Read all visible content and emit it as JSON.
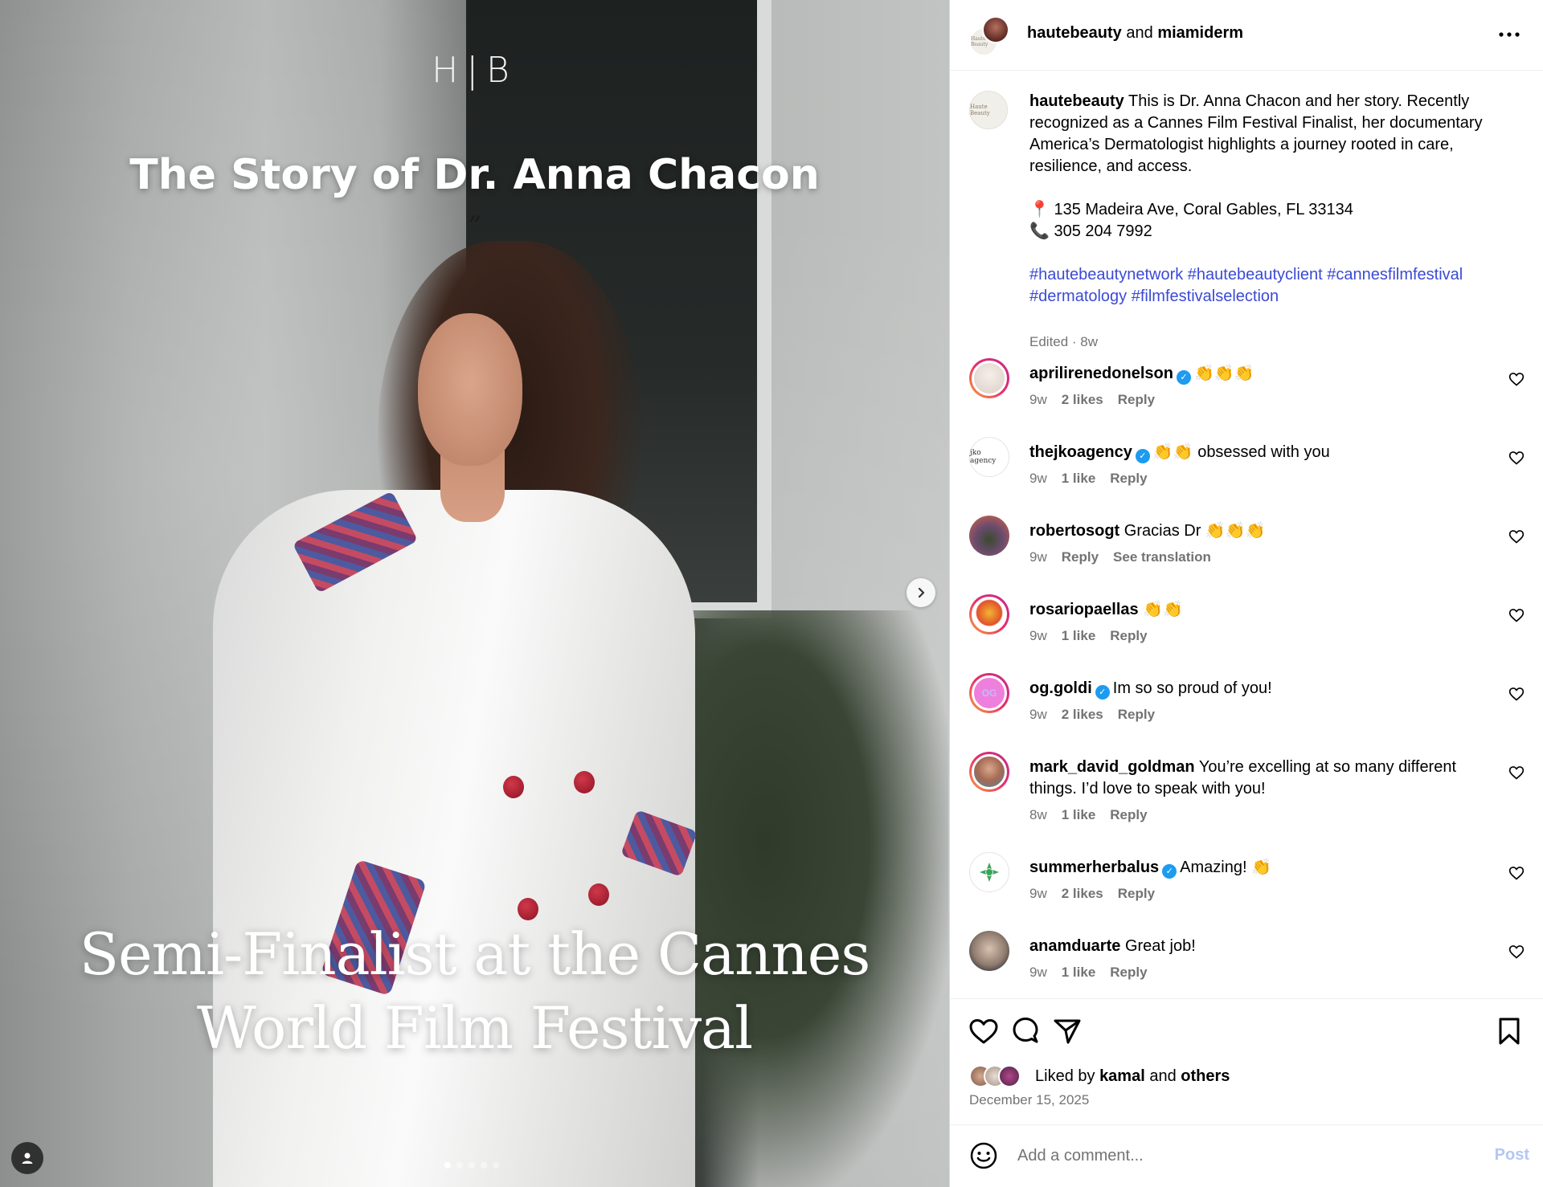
{
  "media": {
    "logo": "H|B",
    "title": "The Story of Dr. Anna Chacon",
    "quote_mark": "”",
    "caption_line1": "Semi-Finalist at the Cannes",
    "caption_line2": "World Film Festival",
    "carousel_total": 5,
    "carousel_active": 1
  },
  "header": {
    "user1": "hautebeauty",
    "joiner": "and",
    "user2": "miamiderm",
    "avatar_label": "Haute Beauty"
  },
  "caption": {
    "username": "hautebeauty",
    "text": "This is Dr. Anna Chacon and her story. Recently recognized as a Cannes Film Festival Finalist, her documentary America’s Dermatologist highlights a journey rooted in care, resilience, and access.",
    "address": "📍 135 Madeira Ave, Coral Gables, FL 33134",
    "phone": "📞 305 204 7992",
    "hashtags": "#hautebeautynetwork #hautebeautyclient #cannesfilmfestival #dermatology #filmfestivalselection",
    "meta": "Edited · 8w"
  },
  "comments": [
    {
      "username": "aprilirenedonelson",
      "verified": true,
      "text": "👏👏👏",
      "time": "9w",
      "likes": "2 likes",
      "action": "Reply",
      "extra": ""
    },
    {
      "username": "thejkoagency",
      "verified": true,
      "text": "👏👏 obsessed with you",
      "time": "9w",
      "likes": "1 like",
      "action": "Reply",
      "extra": ""
    },
    {
      "username": "robertosogt",
      "verified": false,
      "text": "Gracias Dr 👏👏👏",
      "time": "9w",
      "likes": "",
      "action": "Reply",
      "extra": "See translation"
    },
    {
      "username": "rosariopaellas",
      "verified": false,
      "text": "👏👏",
      "time": "9w",
      "likes": "1 like",
      "action": "Reply",
      "extra": ""
    },
    {
      "username": "og.goldi",
      "verified": true,
      "text": "Im so so proud of you!",
      "time": "9w",
      "likes": "2 likes",
      "action": "Reply",
      "extra": ""
    },
    {
      "username": "mark_david_goldman",
      "verified": false,
      "text": "You’re excelling at so many different things. I’d love to speak with you!",
      "time": "8w",
      "likes": "1 like",
      "action": "Reply",
      "extra": ""
    },
    {
      "username": "summerherbalus",
      "verified": true,
      "text": "Amazing! 👏",
      "time": "9w",
      "likes": "2 likes",
      "action": "Reply",
      "extra": ""
    },
    {
      "username": "anamduarte",
      "verified": false,
      "text": "Great job!",
      "time": "9w",
      "likes": "1 like",
      "action": "Reply",
      "extra": ""
    }
  ],
  "jko_avatar_text": "jko agency",
  "og_avatar_text": "OG",
  "likes": {
    "prefix": "Liked by",
    "user": "kamal",
    "joiner": "and",
    "others": "others",
    "date": "December 15, 2025"
  },
  "composer": {
    "placeholder": "Add a comment...",
    "post_label": "Post"
  },
  "colors": {
    "hashtag": "#3b4ad6",
    "verified": "#1d9bf0",
    "post_disabled": "#b3c7f4",
    "secondary_text": "#737373"
  }
}
